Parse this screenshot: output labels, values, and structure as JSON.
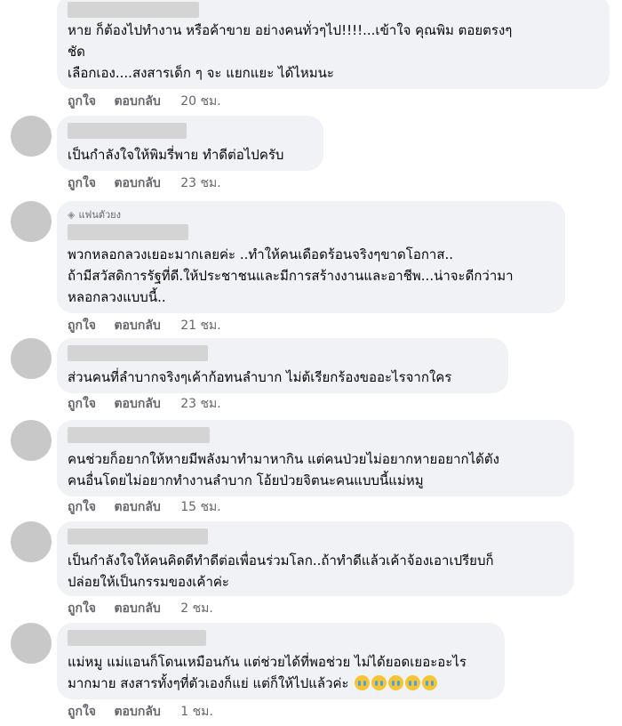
{
  "actions": {
    "like": "ถูกใจ",
    "reply": "ตอบกลับ"
  },
  "comments": [
    {
      "text": "หาย ก็ต้องไปทำงาน หรือค้าขาย อย่างคนทั่วๆไป!!!!...เข้าใจ คุณพิม ตอยตรงๆ\nชัด\nเลือกเอง....สงสารเด็ก ๆ จะ แยกแยะ ได้ไหมนะ",
      "time": "20 ชม."
    },
    {
      "text": "เป็นกำลังใจให้พิมรี่พาย ทำดีต่อไปครับ",
      "time": "23 ชม."
    },
    {
      "badge": "แฟนตัวยง",
      "badge_icon": "diamond-icon",
      "text": "พวกหลอกลวงเยอะมากเลยค่ะ ..ทำให้คนเดือดร้อนจริงๆขาดโอกาส..\nถ้ามีสวัสดิการรัฐที่ดี.ให้ประชาชนและมีการสร้างงานและอาชีพ...น่าจะดีกว่ามา\nหลอกลวงแบบนี้..",
      "time": "21 ชม."
    },
    {
      "text": "ส่วนคนที่ลำบากจริงๆเค้าก้อทนลำบาก ไม่ต้เรียกร้องขออะไรจากใคร",
      "time": "23 ชม."
    },
    {
      "text": "คนช่วยก็อยากให้หายมีพลังมาทำมาหากิน แต่คนป่วยไม่อยากหายอยากได้ตัง\nคนอื่นโดยไม่อยากทำงานลำบาก โอ้ยป่วยจิตนะคนแบบนี้แม่หมู",
      "time": "15 ชม."
    },
    {
      "text": "เป็นกำลังใจให้คนคิดดีทำดีต่อเพื่อนร่วมโลก..ถ้าทำดีแล้วเค้าจ้องเอาเปรียบก็\nปล่อยให้เป็นกรรมของเค้าค่ะ",
      "time": "2 ชม."
    },
    {
      "text": "แม่หมู แม่แอนก็โดนเหมือนกัน แต่ช่วยได้ที่พอช่วย ไม่ได้ยอดเยอะอะไร\nมากมาย สงสารทั้งๆที่ตัวเองก็แย่ แต่ก็ให้ไปแล้วค่ะ",
      "emojis": [
        "crying-face-icon",
        "crying-face-icon",
        "crying-face-icon",
        "crying-face-icon",
        "crying-face-icon"
      ],
      "time": "1 ชม."
    }
  ]
}
